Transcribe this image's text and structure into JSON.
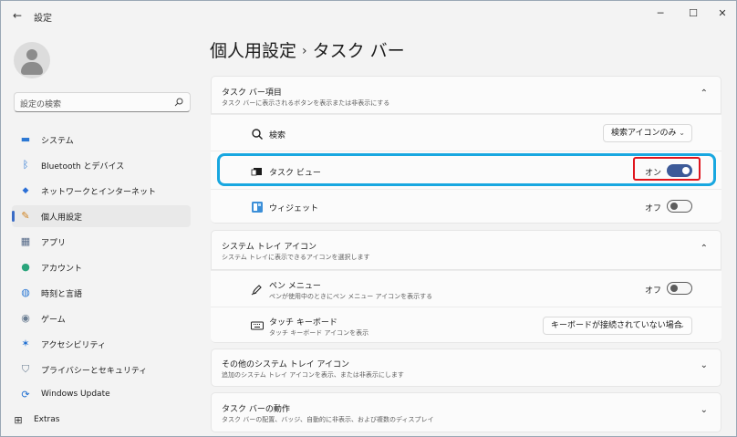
{
  "window": {
    "title": "設定",
    "back": "←",
    "minimize": "─",
    "maximize": "☐",
    "close": "✕"
  },
  "sidebar": {
    "search_placeholder": "設定の検索",
    "items": [
      {
        "label": "システム",
        "icon": "monitor-icon",
        "glyph": "▬",
        "color": "#2b78d4"
      },
      {
        "label": "Bluetooth とデバイス",
        "icon": "bluetooth-icon",
        "glyph": "ᛒ",
        "color": "#1f6fd1"
      },
      {
        "label": "ネットワークとインターネット",
        "icon": "wifi-icon",
        "glyph": "◆",
        "color": "#2b6fd6"
      },
      {
        "label": "個人用設定",
        "icon": "brush-icon",
        "glyph": "✎",
        "color": "#d0821f"
      },
      {
        "label": "アプリ",
        "icon": "apps-icon",
        "glyph": "▦",
        "color": "#566a88"
      },
      {
        "label": "アカウント",
        "icon": "account-icon",
        "glyph": "●",
        "color": "#2aa57c"
      },
      {
        "label": "時刻と言語",
        "icon": "globe-clock-icon",
        "glyph": "◍",
        "color": "#2b78d4"
      },
      {
        "label": "ゲーム",
        "icon": "gamepad-icon",
        "glyph": "◉",
        "color": "#6a7d92"
      },
      {
        "label": "アクセシビリティ",
        "icon": "accessibility-icon",
        "glyph": "✶",
        "color": "#1f6fd1"
      },
      {
        "label": "プライバシーとセキュリティ",
        "icon": "shield-icon",
        "glyph": "⛉",
        "color": "#6a7d92"
      },
      {
        "label": "Windows Update",
        "icon": "update-icon",
        "glyph": "⟳",
        "color": "#1f6fd1"
      },
      {
        "label": "Extras",
        "icon": "extras-icon",
        "glyph": "⊞",
        "color": "#333333"
      }
    ],
    "active_index": 3
  },
  "main": {
    "breadcrumb_parent": "個人用設定",
    "breadcrumb_sep": "›",
    "breadcrumb_current": "タスク バー",
    "taskbar_items": {
      "title": "タスク バー項目",
      "subtitle": "タスク バーに表示されるボタンを表示または非表示にする",
      "rows": [
        {
          "label": "検索",
          "icon": "search-icon",
          "control": "dropdown",
          "value": "検索アイコンのみ"
        },
        {
          "label": "タスク ビュー",
          "icon": "task-view-icon",
          "control": "toggle",
          "state": "オン",
          "on": true
        },
        {
          "label": "ウィジェット",
          "icon": "widgets-icon",
          "control": "toggle",
          "state": "オフ",
          "on": false
        }
      ]
    },
    "system_tray": {
      "title": "システム トレイ アイコン",
      "subtitle": "システム トレイに表示できるアイコンを選択します",
      "rows": [
        {
          "label": "ペン メニュー",
          "sub": "ペンが使用中のときにペン メニュー アイコンを表示する",
          "icon": "pen-icon",
          "state": "オフ"
        },
        {
          "label": "タッチ キーボード",
          "sub": "タッチ キーボード アイコンを表示",
          "icon": "keyboard-icon",
          "value": "キーボードが接続されていない場合"
        }
      ]
    },
    "other_tray": {
      "title": "その他のシステム トレイ アイコン",
      "subtitle": "追加のシステム トレイ アイコンを表示、または非表示にします"
    },
    "behaviors": {
      "title": "タスク バーの動作",
      "subtitle": "タスク バーの配置、バッジ、自動的に非表示、および複数のディスプレイ"
    },
    "chevron_up": "⌃",
    "chevron_down": "⌄"
  }
}
